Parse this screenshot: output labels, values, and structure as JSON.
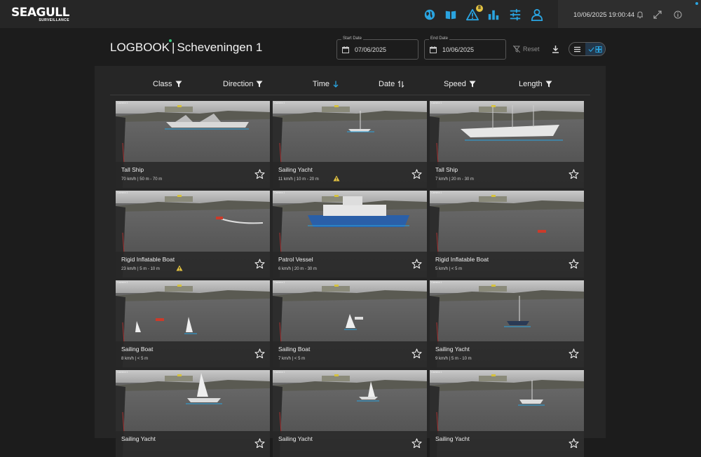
{
  "app": {
    "logo_main": "SEAGULL",
    "logo_sub": "SURVEILLANCE",
    "nav_icons": [
      "globe-icon",
      "book-icon",
      "alert-icon",
      "chart-icon",
      "sliders-icon",
      "user-icon"
    ],
    "alert_count": "8",
    "clock": "10/06/2025 19:00:44",
    "accent_color": "#2aa4e0",
    "badge_color": "#e4c442"
  },
  "page": {
    "title_left": "LOGBOOK",
    "title_sep": "|",
    "title_right": "Scheveningen 1"
  },
  "filters": {
    "start_label": "Start Date",
    "start_value": "07/06/2025",
    "end_label": "End Date",
    "end_value": "10/06/2025",
    "reset_label": "Reset"
  },
  "columns": [
    {
      "label": "Class",
      "icon": "filter-icon"
    },
    {
      "label": "Direction",
      "icon": "filter-icon"
    },
    {
      "label": "Time",
      "icon": "sort-down-icon"
    },
    {
      "label": "Date",
      "icon": "sort-icon"
    },
    {
      "label": "Speed",
      "icon": "filter-icon"
    },
    {
      "label": "Length",
      "icon": "filter-icon"
    }
  ],
  "camera_label": "Camera 1",
  "cards": [
    {
      "class": "Tall Ship",
      "meta": "70 km/h | 50 m - 70 m",
      "warning": false
    },
    {
      "class": "Sailing Yacht",
      "meta": "11 km/h | 10 m - 20 m",
      "warning": true
    },
    {
      "class": "Tall Ship",
      "meta": "7 km/h | 20 m - 30 m",
      "warning": false
    },
    {
      "class": "Rigid Inflatable Boat",
      "meta": "23 km/h | 5 m - 10 m",
      "warning": true
    },
    {
      "class": "Patrol Vessel",
      "meta": "6 km/h | 20 m - 30 m",
      "warning": false
    },
    {
      "class": "Rigid Inflatable Boat",
      "meta": "5 km/h | < 5 m",
      "warning": false
    },
    {
      "class": "Sailing Boat",
      "meta": "8 km/h | < 5 m",
      "warning": false
    },
    {
      "class": "Sailing Boat",
      "meta": "7 km/h | < 5 m",
      "warning": false
    },
    {
      "class": "Sailing Yacht",
      "meta": "9 km/h | 5 m - 10 m",
      "warning": false
    },
    {
      "class": "Sailing Yacht",
      "meta": "",
      "warning": false
    },
    {
      "class": "Sailing Yacht",
      "meta": "",
      "warning": false
    },
    {
      "class": "Sailing Yacht",
      "meta": "",
      "warning": false
    }
  ]
}
